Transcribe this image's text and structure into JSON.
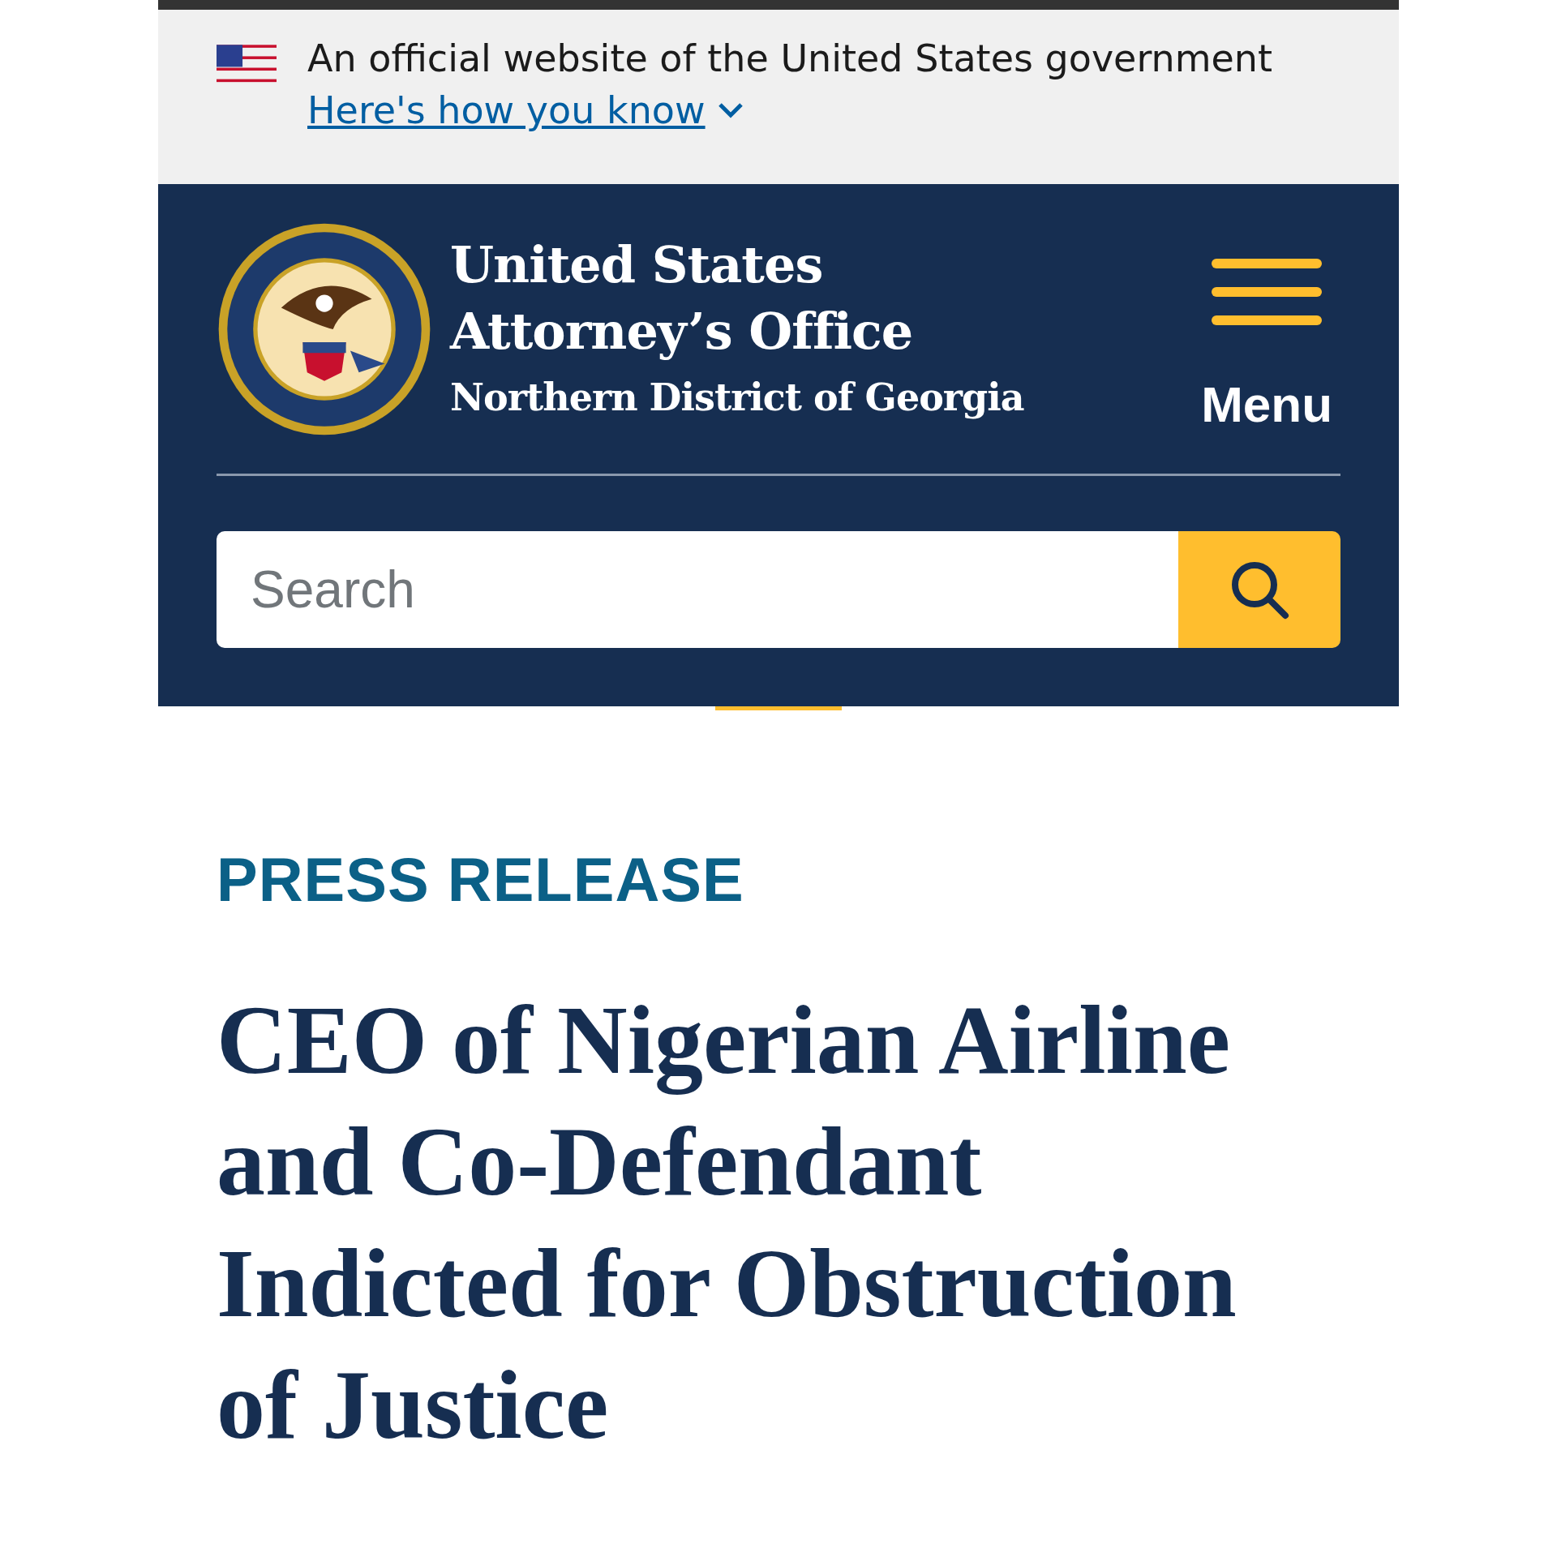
{
  "gov_banner": {
    "text": "An official website of the United States government",
    "link": "Here's how you know",
    "expanded": false
  },
  "header": {
    "title_line_1": "United States",
    "title_line_2": "Attorney’s Office",
    "subtitle": "Northern District of Georgia",
    "menu_label": "Menu"
  },
  "search": {
    "placeholder": "Search"
  },
  "article": {
    "label": "PRESS RELEASE",
    "title": "CEO of Nigerian Airline and Co-Defendant Indicted for Obstruction of Justice"
  }
}
